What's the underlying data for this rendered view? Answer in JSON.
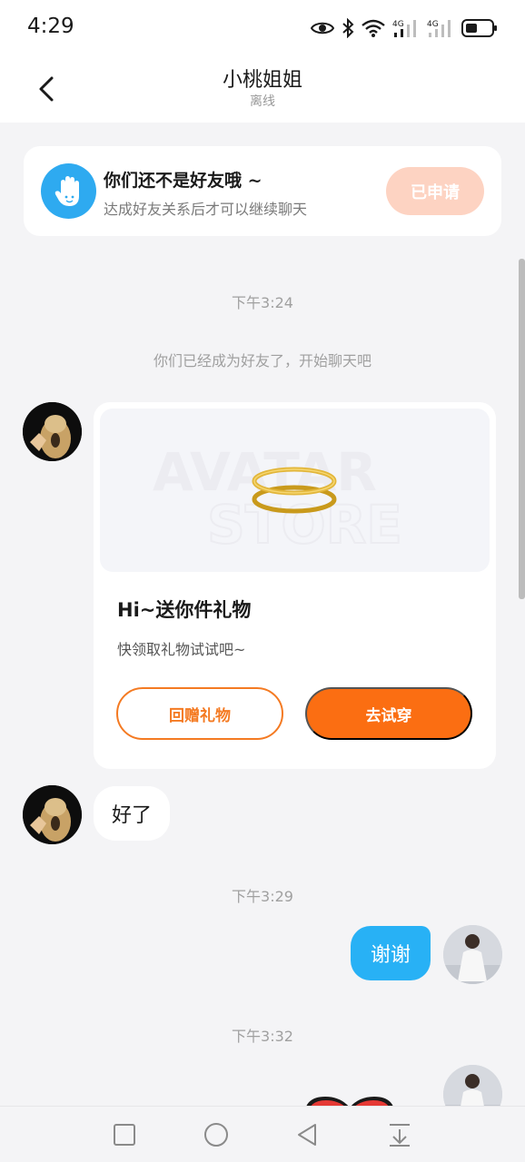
{
  "status_bar": {
    "time": "4:29",
    "network_1": "4G",
    "network_2": "4G"
  },
  "header": {
    "title": "小桃姐姐",
    "subtitle": "离线"
  },
  "friend_banner": {
    "title": "你们还不是好友哦 ~",
    "description": "达成好友关系后才可以继续聊天",
    "button_label": "已申请"
  },
  "messages": {
    "timestamp_1": "下午3:24",
    "system_text": "你们已经成为好友了，开始聊天吧",
    "gift_card": {
      "watermark_line_1": "AVATAR",
      "watermark_line_2": "STORE",
      "title": "Hi~送你件礼物",
      "description": "快领取礼物试试吧~",
      "return_button": "回赠礼物",
      "try_button": "去试穿"
    },
    "received_text": "好了",
    "timestamp_2": "下午3:29",
    "sent_text": "谢谢",
    "timestamp_3": "下午3:32"
  },
  "colors": {
    "accent_orange": "#fb6e12",
    "bubble_blue": "#28b1f5",
    "banner_icon_blue": "#2eaaf0",
    "applied_button": "#fdd3c2"
  },
  "icons": {
    "back": "chevron-left-icon",
    "eye": "eye-icon",
    "bluetooth": "bluetooth-icon",
    "wifi": "wifi-icon",
    "battery": "battery-icon",
    "hand": "hand-wave-icon",
    "gift": "gold-halo-icon",
    "nav_recent": "square-icon",
    "nav_home": "circle-icon",
    "nav_back": "triangle-back-icon",
    "nav_menu": "download-menu-icon"
  }
}
